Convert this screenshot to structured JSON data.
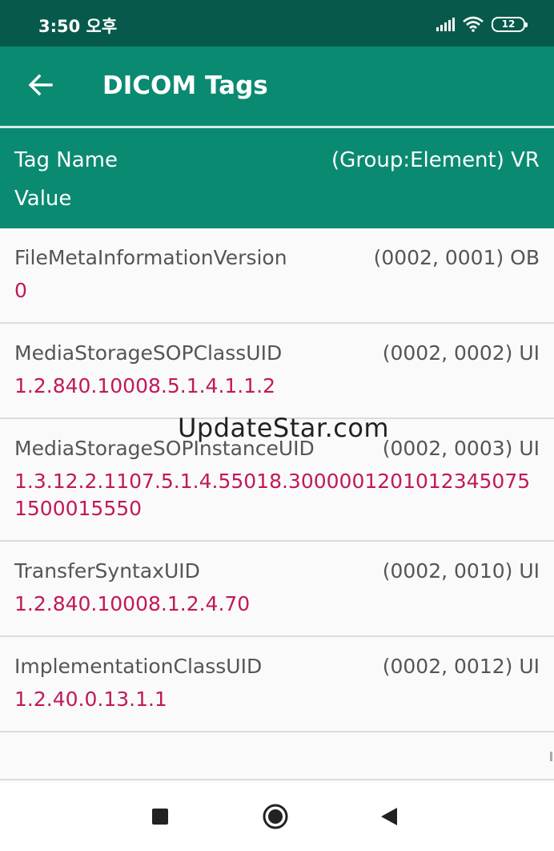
{
  "status": {
    "time": "3:50 오후",
    "battery": "12"
  },
  "app_bar": {
    "title": "DICOM Tags"
  },
  "table_header": {
    "name": "Tag Name",
    "group": "(Group:Element) VR",
    "value": "Value"
  },
  "tags": [
    {
      "name": "FileMetaInformationVersion",
      "code": "(0002, 0001) OB",
      "value": "0"
    },
    {
      "name": "MediaStorageSOPClassUID",
      "code": "(0002, 0002) UI",
      "value": "1.2.840.10008.5.1.4.1.1.2"
    },
    {
      "name": "MediaStorageSOPInstanceUID",
      "code": "(0002, 0003) UI",
      "value": "1.3.12.2.1107.5.1.4.55018.30000012010123450751500015550"
    },
    {
      "name": "TransferSyntaxUID",
      "code": "(0002, 0010) UI",
      "value": "1.2.840.10008.1.2.4.70"
    },
    {
      "name": "ImplementationClassUID",
      "code": "(0002, 0012) UI",
      "value": "1.2.40.0.13.1.1"
    }
  ],
  "watermark": "UpdateStar.com",
  "colors": {
    "status_bar": "#075a4b",
    "app_bar": "#0b8a72",
    "value_text": "#c2185b"
  },
  "icons": {
    "back": "arrow-back-icon",
    "recents": "square-icon",
    "home": "circle-icon",
    "back_nav": "triangle-back-icon"
  }
}
